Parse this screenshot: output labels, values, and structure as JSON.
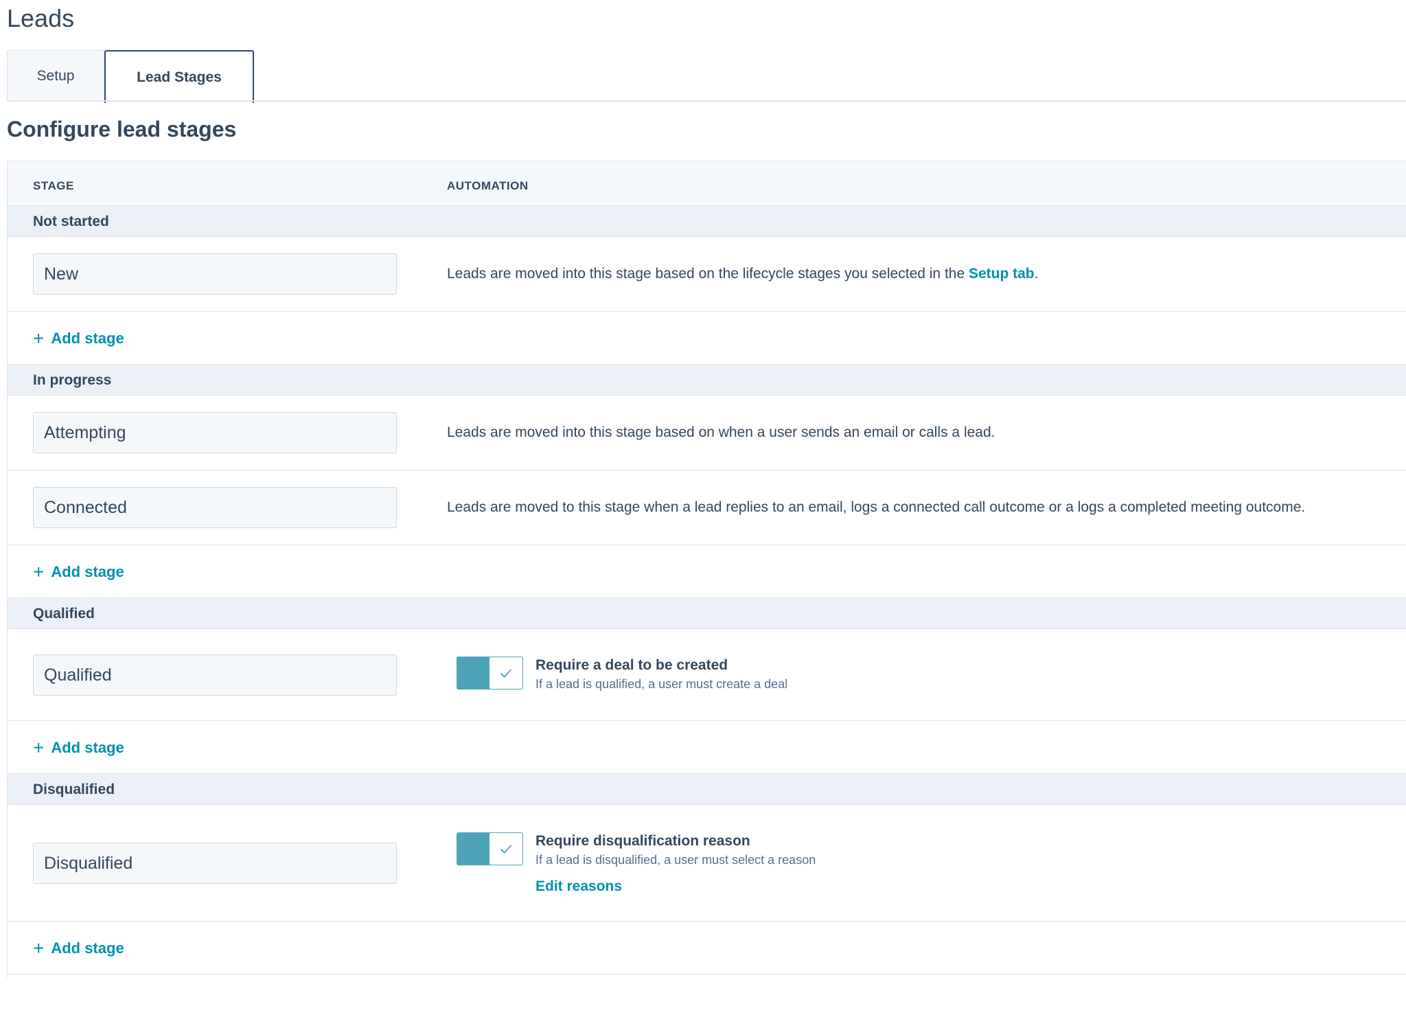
{
  "page": {
    "title": "Leads"
  },
  "tabs": [
    {
      "label": "Setup"
    },
    {
      "label": "Lead Stages"
    }
  ],
  "section_title": "Configure lead stages",
  "table": {
    "headers": {
      "stage": "STAGE",
      "automation": "AUTOMATION"
    },
    "add_stage_label": "Add stage",
    "groups": [
      {
        "label": "Not started",
        "stages": [
          {
            "name": "New",
            "automation_text": "Leads are moved into this stage based on the lifecycle stages you selected in the ",
            "automation_link": "Setup tab",
            "automation_suffix": "."
          }
        ]
      },
      {
        "label": "In progress",
        "stages": [
          {
            "name": "Attempting",
            "automation_text": "Leads are moved into this stage based on when a user sends an email or calls a lead."
          },
          {
            "name": "Connected",
            "automation_text": "Leads are moved to this stage when a lead replies to an email, logs a connected call outcome or a logs a completed meeting outcome."
          }
        ]
      },
      {
        "label": "Qualified",
        "stages": [
          {
            "name": "Qualified",
            "toggle_on": true,
            "toggle_title": "Require a deal to be created",
            "toggle_desc": "If a lead is qualified, a user must create a deal"
          }
        ]
      },
      {
        "label": "Disqualified",
        "stages": [
          {
            "name": "Disqualified",
            "toggle_on": true,
            "toggle_title": "Require disqualification reason",
            "toggle_desc": "If a lead is disqualified, a user must select a reason",
            "link": "Edit reasons"
          }
        ]
      }
    ]
  },
  "colors": {
    "accent": "#0091ae",
    "toggle": "#4ea3b9",
    "text": "#33475b",
    "group_bg": "#eaf0f6"
  }
}
